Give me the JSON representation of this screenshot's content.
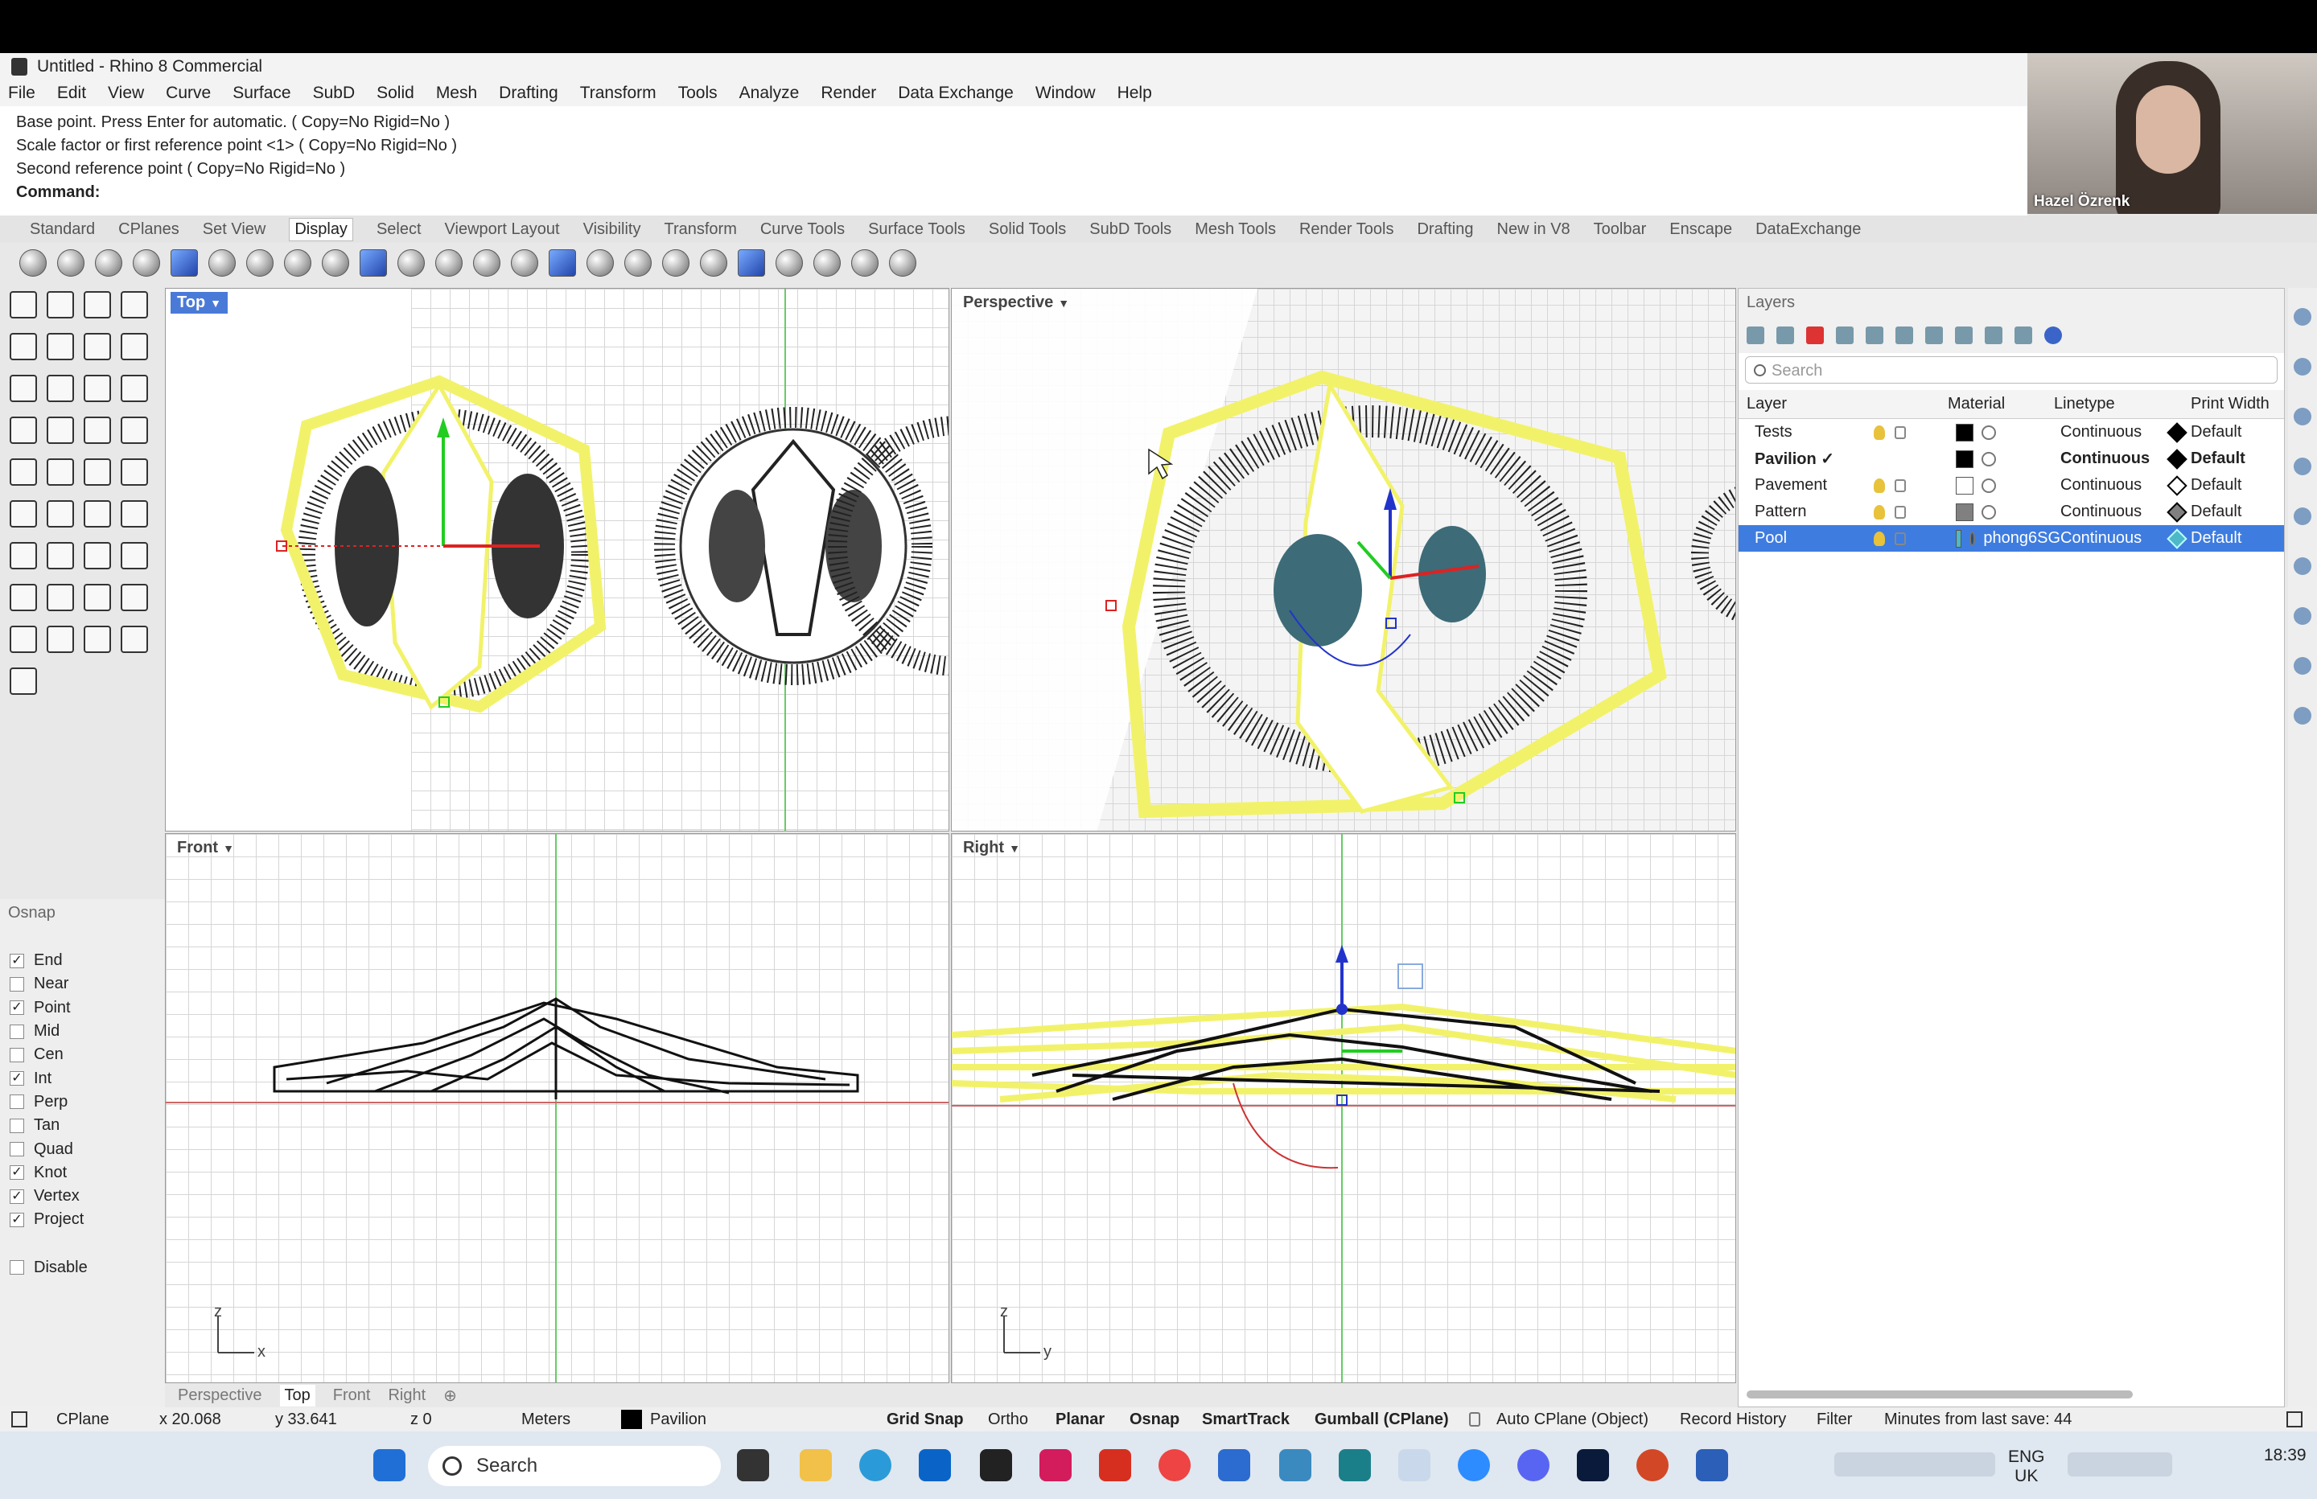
{
  "window": {
    "title": "Untitled - Rhino 8 Commercial"
  },
  "menu": [
    "File",
    "Edit",
    "View",
    "Curve",
    "Surface",
    "SubD",
    "Solid",
    "Mesh",
    "Drafting",
    "Transform",
    "Tools",
    "Analyze",
    "Render",
    "Data Exchange",
    "Window",
    "Help"
  ],
  "command_history": [
    "Base point. Press Enter for automatic. ( Copy=No  Rigid=No )",
    "Scale factor or first reference point <1> ( Copy=No  Rigid=No )",
    "Second reference point ( Copy=No  Rigid=No )"
  ],
  "command_label": "Command:",
  "webcam": {
    "name": "Hazel Özrenk"
  },
  "toolbar_tabs": [
    "Standard",
    "CPlanes",
    "Set View",
    "Display",
    "Select",
    "Viewport Layout",
    "Visibility",
    "Transform",
    "Curve Tools",
    "Surface Tools",
    "Solid Tools",
    "SubD Tools",
    "Mesh Tools",
    "Render Tools",
    "Drafting",
    "New in V8",
    "Toolbar",
    "Enscape",
    "DataExchange"
  ],
  "active_tab": "Display",
  "viewports": {
    "top": "Top",
    "perspective": "Perspective",
    "front": "Front",
    "right": "Right"
  },
  "axes": {
    "front_v": "z",
    "front_h": "x",
    "right_v": "z",
    "right_h": "y"
  },
  "osnap": {
    "title": "Osnap",
    "items": [
      {
        "label": "End",
        "on": true
      },
      {
        "label": "Near",
        "on": false
      },
      {
        "label": "Point",
        "on": true
      },
      {
        "label": "Mid",
        "on": false
      },
      {
        "label": "Cen",
        "on": false
      },
      {
        "label": "Int",
        "on": true
      },
      {
        "label": "Perp",
        "on": false
      },
      {
        "label": "Tan",
        "on": false
      },
      {
        "label": "Quad",
        "on": false
      },
      {
        "label": "Knot",
        "on": true
      },
      {
        "label": "Vertex",
        "on": true
      },
      {
        "label": "Project",
        "on": true
      }
    ],
    "disable": "Disable"
  },
  "layers": {
    "title": "Layers",
    "search_placeholder": "Search",
    "headers": [
      "Layer",
      "Material",
      "Linetype",
      "Print Width"
    ],
    "rows": [
      {
        "name": "Tests",
        "color": "#000000",
        "material": "",
        "linetype": "Continuous",
        "width": "Default",
        "current": false,
        "selected": false
      },
      {
        "name": "Pavilion",
        "color": "#000000",
        "material": "",
        "linetype": "Continuous",
        "width": "Default",
        "current": true,
        "selected": false
      },
      {
        "name": "Pavement",
        "color": "#ffffff",
        "material": "",
        "linetype": "Continuous",
        "width": "Default",
        "current": false,
        "selected": false
      },
      {
        "name": "Pattern",
        "color": "#808080",
        "material": "",
        "linetype": "Continuous",
        "width": "Default",
        "current": false,
        "selected": false
      },
      {
        "name": "Pool",
        "color": "#4db8c8",
        "material": "phong6SG",
        "linetype": "Continuous",
        "width": "Default",
        "current": false,
        "selected": true
      }
    ]
  },
  "view_tabs": [
    "Perspective",
    "Top",
    "Front",
    "Right"
  ],
  "active_view_tab": "Top",
  "status": {
    "cplane": "CPlane",
    "x": "x 20.068",
    "y": "y 33.641",
    "z": "z 0",
    "units": "Meters",
    "layer": "Pavilion",
    "grid_snap": "Grid Snap",
    "ortho": "Ortho",
    "planar": "Planar",
    "osnap": "Osnap",
    "smarttrack": "SmartTrack",
    "gumball": "Gumball (CPlane)",
    "auto_cplane": "Auto CPlane (Object)",
    "record": "Record History",
    "filter": "Filter",
    "save": "Minutes from last save: 44"
  },
  "taskbar": {
    "search": "Search",
    "lang1": "ENG",
    "lang2": "UK",
    "time": "18:39"
  },
  "colors": {
    "selection": "#f2f26a",
    "accent": "#3e7ce0"
  }
}
